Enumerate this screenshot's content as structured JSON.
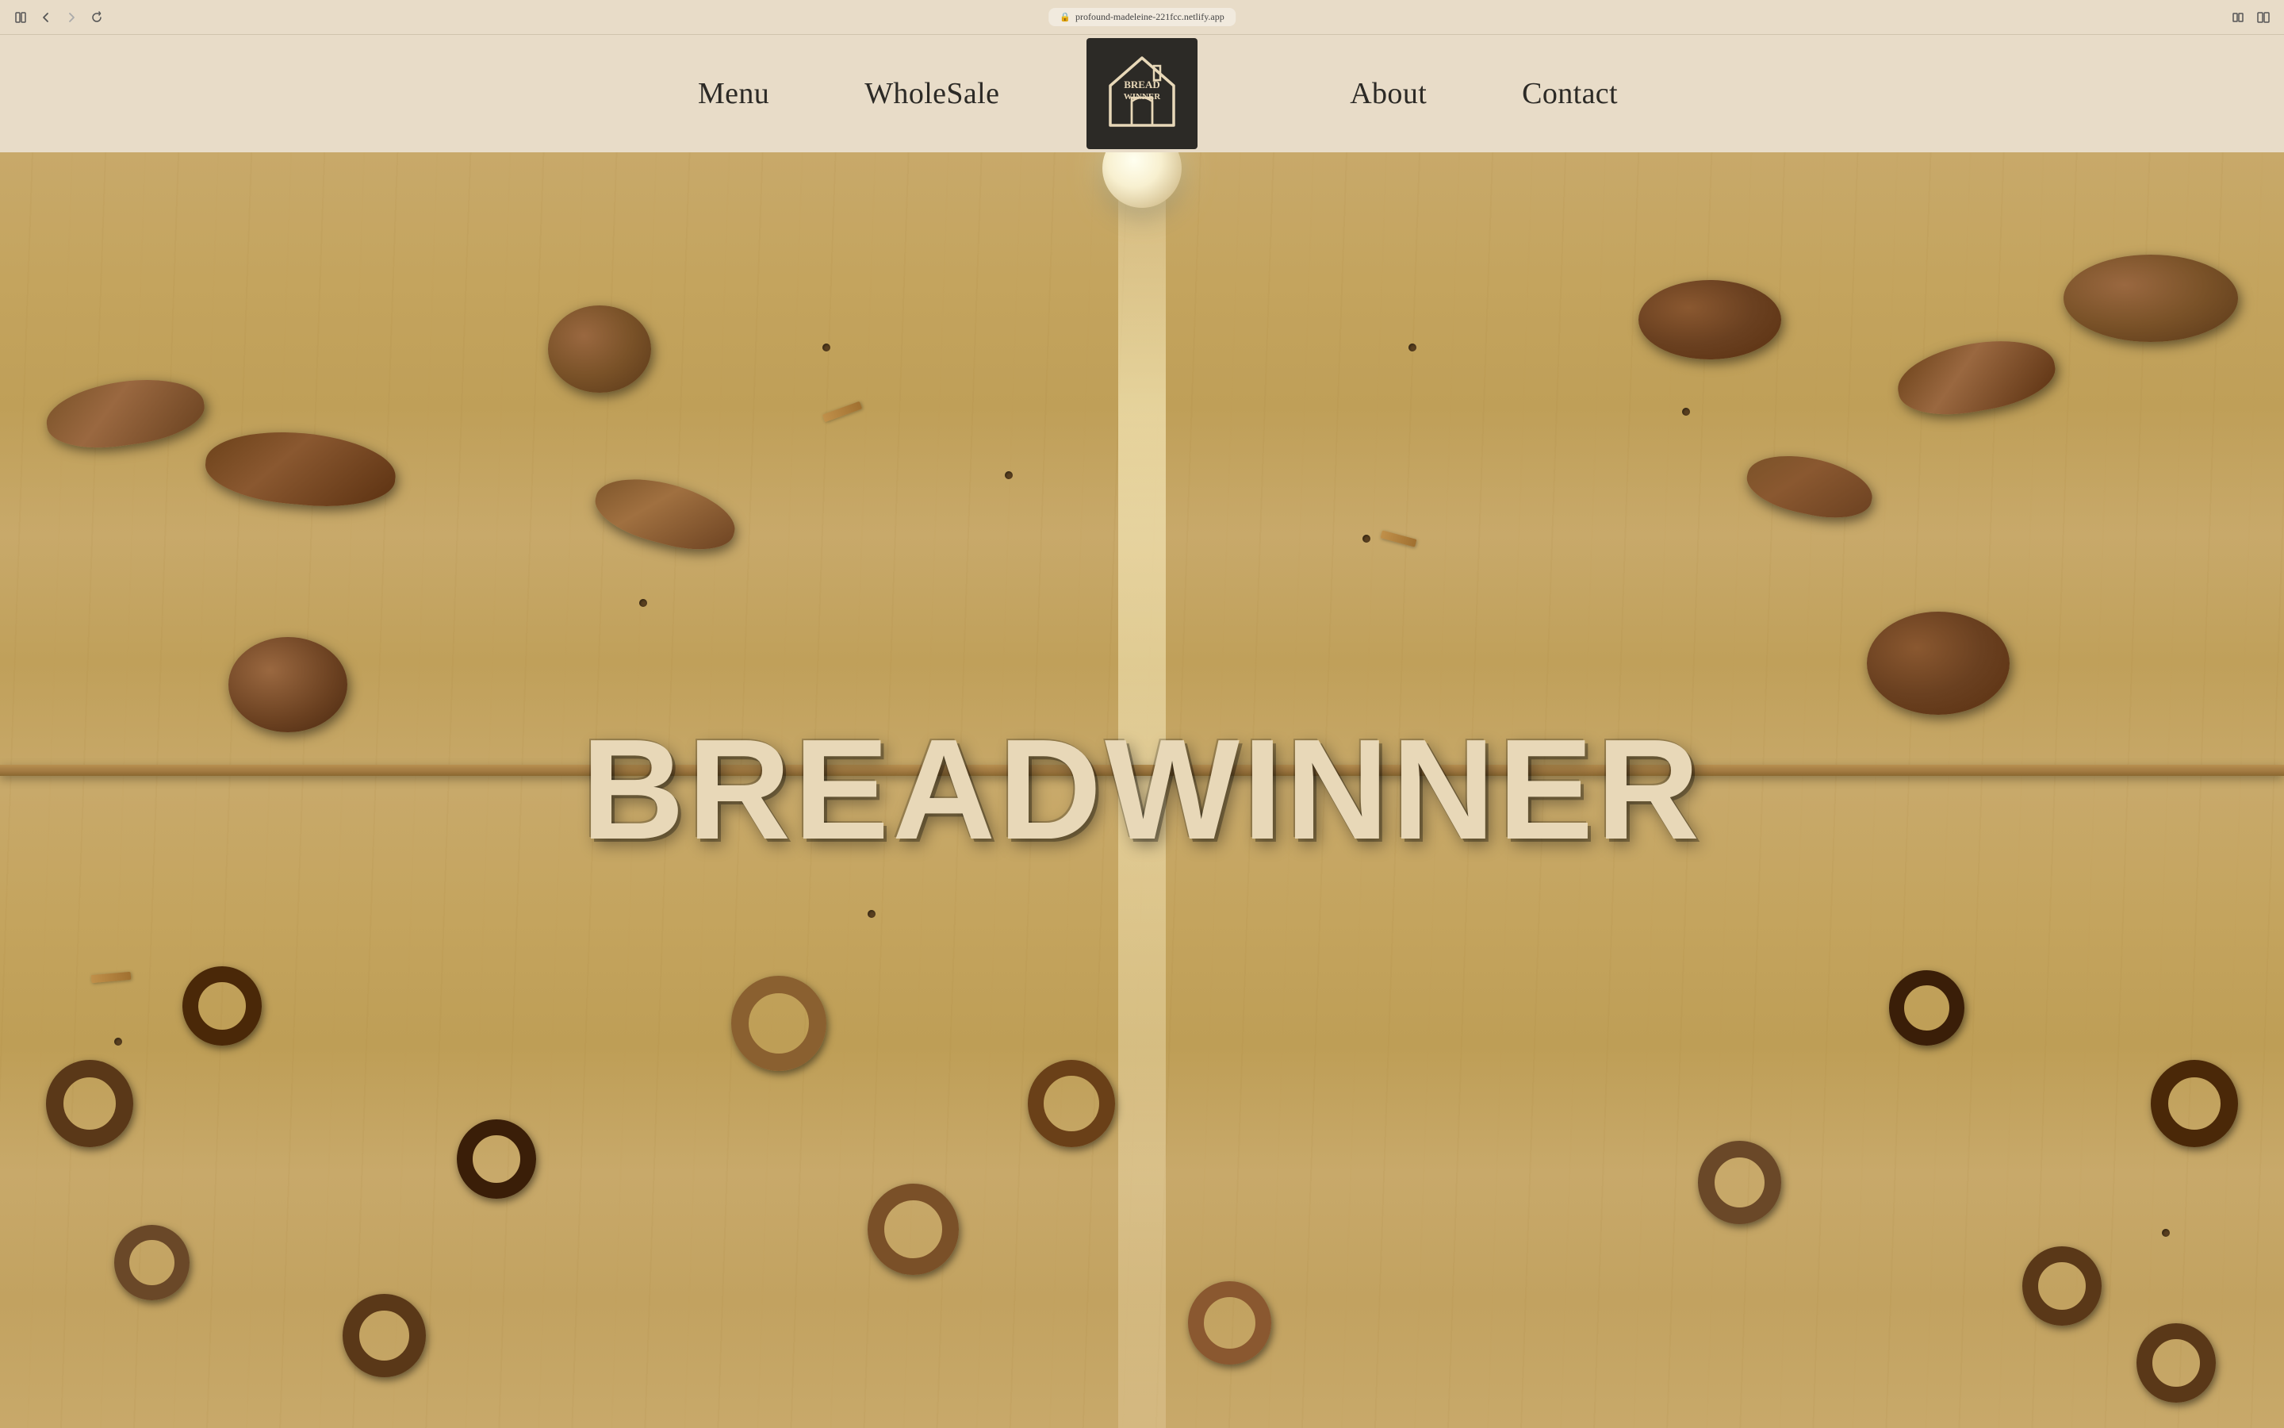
{
  "browser": {
    "url": "profound-madeleine-221fcc.netlify.app",
    "back_title": "back",
    "forward_title": "forward",
    "reload_title": "reload",
    "sidebar_title": "sidebar",
    "split_title": "split view"
  },
  "nav": {
    "menu_label": "Menu",
    "wholesale_label": "WholeSale",
    "about_label": "About",
    "contact_label": "Contact",
    "logo_alt": "Bread Winner"
  },
  "hero": {
    "title": "BREADWINNER"
  }
}
